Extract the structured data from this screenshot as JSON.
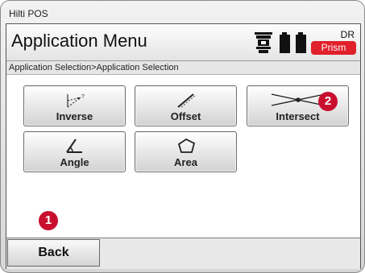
{
  "window": {
    "title": "Hilti POS"
  },
  "header": {
    "title": "Application Menu",
    "instrument_icon": "total-station-icon",
    "battery_icon": "battery-icon",
    "mode_top": "DR",
    "mode_bottom": "Prism"
  },
  "breadcrumb": "Application Selection>Application Selection",
  "apps": [
    {
      "label": "Inverse",
      "icon": "inverse-icon"
    },
    {
      "label": "Offset",
      "icon": "offset-icon"
    },
    {
      "label": "Intersect",
      "icon": "intersect-icon"
    },
    {
      "label": "Angle",
      "icon": "angle-icon"
    },
    {
      "label": "Area",
      "icon": "area-icon"
    }
  ],
  "markers": {
    "back": "1",
    "intersect": "2"
  },
  "footer": {
    "back_label": "Back"
  },
  "colors": {
    "accent": "#e0202a",
    "marker": "#c8102e"
  }
}
